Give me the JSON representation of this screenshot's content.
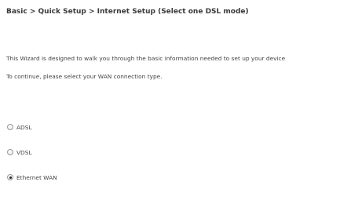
{
  "breadcrumb": "Basic > Quick Setup > Internet Setup (Select one DSL mode)",
  "intro": {
    "line1": "This Wizard is designed to walk you through the basic information needed to set up your device",
    "line2": "To continue, please select your WAN connection type."
  },
  "options": [
    {
      "label": "ADSL",
      "selected": false
    },
    {
      "label": "VDSL",
      "selected": false
    },
    {
      "label": "Ethernet WAN",
      "selected": true
    }
  ]
}
